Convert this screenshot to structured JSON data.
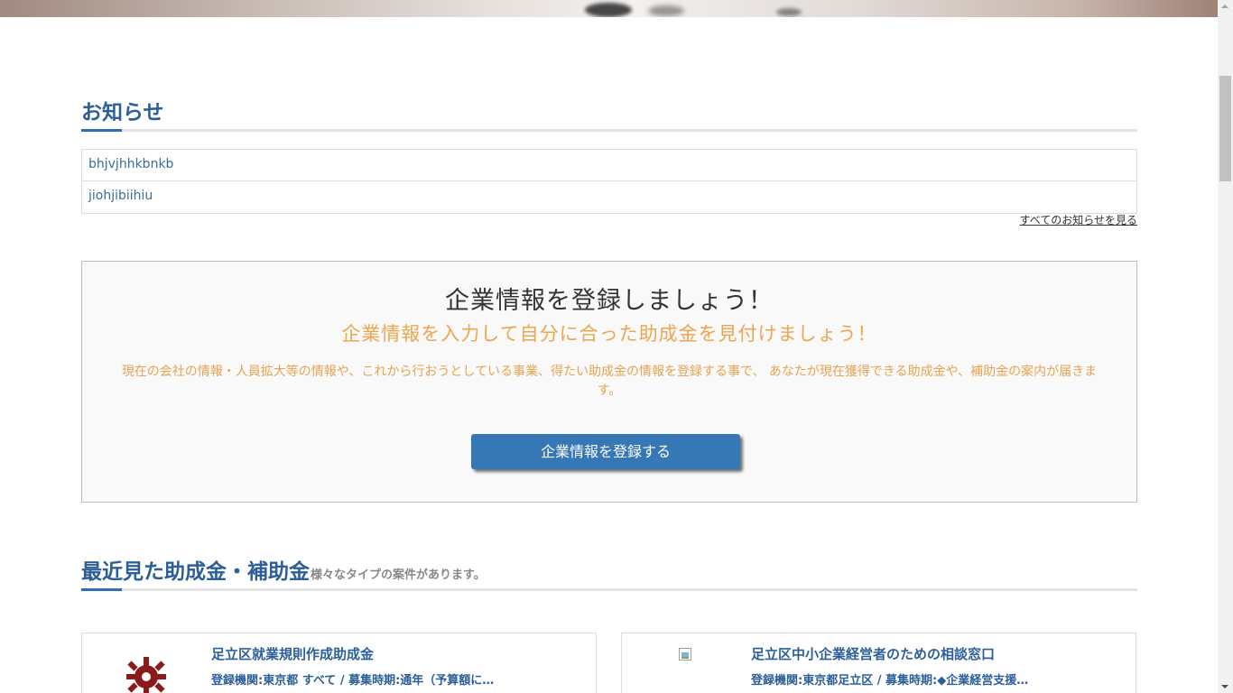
{
  "news": {
    "title": "お知らせ",
    "items": [
      {
        "label": "bhjvjhhkbnkb"
      },
      {
        "label": "jiohjibiihiu"
      }
    ],
    "view_all": "すべてのお知らせを見る"
  },
  "cta": {
    "title": "企業情報を登録しましょう！",
    "subtitle": "企業情報を入力して自分に合った助成金を見付けましょう！",
    "description": "現在の会社の情報・人員拡大等の情報や、これから行おうとしている事業、得たい助成金の情報を登録する事で、 あなたが現在獲得できる助成金や、補助金の案内が届きます。",
    "button_label": "企業情報を登録する"
  },
  "recent": {
    "title": "最近見た助成金・補助金",
    "subtitle": "様々なタイプの案件があります。",
    "cards": [
      {
        "title": "足立区就業規則作成助成金",
        "meta": "登録機関:東京都 すべて / 募集時期:通年（予算額に…",
        "icon": "adachi-emblem-icon"
      },
      {
        "title": "足立区中小企業経営者のための相談窓口",
        "meta": "登録機関:東京都足立区 / 募集時期:◆企業経営支援…",
        "icon": "broken-image-icon"
      }
    ]
  },
  "colors": {
    "accent_blue": "#2c5f98",
    "button_blue": "#3578b5",
    "orange_text": "#eda64f",
    "emblem_red": "#8b1a1a"
  }
}
